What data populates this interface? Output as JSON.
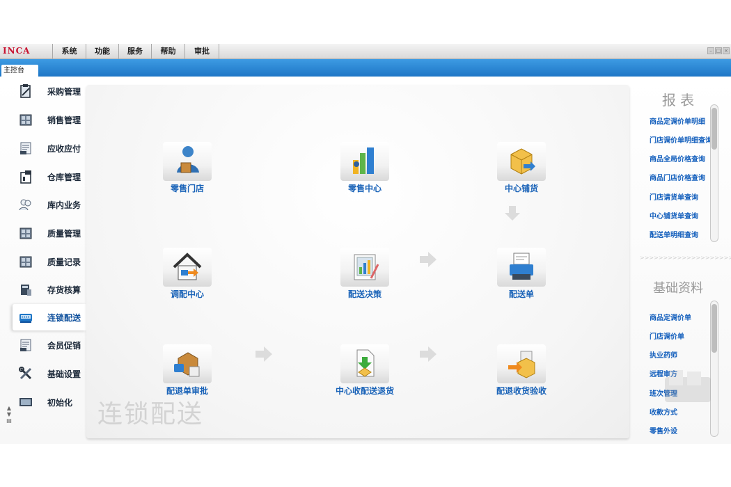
{
  "app": {
    "logo": "INCA"
  },
  "menu": [
    "系统",
    "功能",
    "服务",
    "帮助",
    "审批"
  ],
  "window_controls": [
    "minimize-icon",
    "restore-icon",
    "close-icon"
  ],
  "tabs": {
    "main": "主控台"
  },
  "sidebar": {
    "items": [
      {
        "label": "采购管理",
        "icon": "clipboard-icon"
      },
      {
        "label": "销售管理",
        "icon": "cabinet-icon"
      },
      {
        "label": "应收应付",
        "icon": "ledger-icon"
      },
      {
        "label": "仓库管理",
        "icon": "warehouse-icon"
      },
      {
        "label": "库内业务",
        "icon": "users-icon"
      },
      {
        "label": "质量管理",
        "icon": "cabinet-icon"
      },
      {
        "label": "质量记录",
        "icon": "cabinet-icon"
      },
      {
        "label": "存货核算",
        "icon": "calculator-icon"
      },
      {
        "label": "连锁配送",
        "icon": "delivery-icon",
        "active": true
      },
      {
        "label": "会员促销",
        "icon": "ledger-icon"
      },
      {
        "label": "基础设置",
        "icon": "tools-icon"
      },
      {
        "label": "初始化",
        "icon": "monitor-icon"
      }
    ]
  },
  "panel": {
    "watermark": "连锁配送",
    "functions": [
      {
        "label": "零售门店",
        "icon": "store-person-icon"
      },
      {
        "label": "零售中心",
        "icon": "bar-chart-icon"
      },
      {
        "label": "中心铺货",
        "icon": "box-arrow-icon"
      },
      {
        "label": "调配中心",
        "icon": "house-icon"
      },
      {
        "label": "配送决策",
        "icon": "chart-doc-icon"
      },
      {
        "label": "配送单",
        "icon": "printer-icon"
      },
      {
        "label": "配退单审批",
        "icon": "return-box-icon"
      },
      {
        "label": "中心收配送退货",
        "icon": "doc-download-icon"
      },
      {
        "label": "配退收货验收",
        "icon": "box-transfer-icon"
      }
    ]
  },
  "reports": {
    "title": "报  表",
    "links": [
      "商品定调价单明细",
      "门店调价单明细查询",
      "商品全局价格查询",
      "商品门店价格查询",
      "门店请货单查询",
      "中心铺货单查询",
      "配送单明细查询"
    ]
  },
  "basic_data": {
    "title": "基础资料",
    "links": [
      "商品定调价单",
      "门店调价单",
      "执业药师",
      "远程审方",
      "班次管理",
      "收款方式",
      "零售外设"
    ]
  },
  "divider": ">>>>>>>>>>>>>>>>>>>>>>",
  "colors": {
    "accent_blue": "#1e76c6",
    "link": "#1560bd",
    "logo_red": "#c8102e"
  }
}
